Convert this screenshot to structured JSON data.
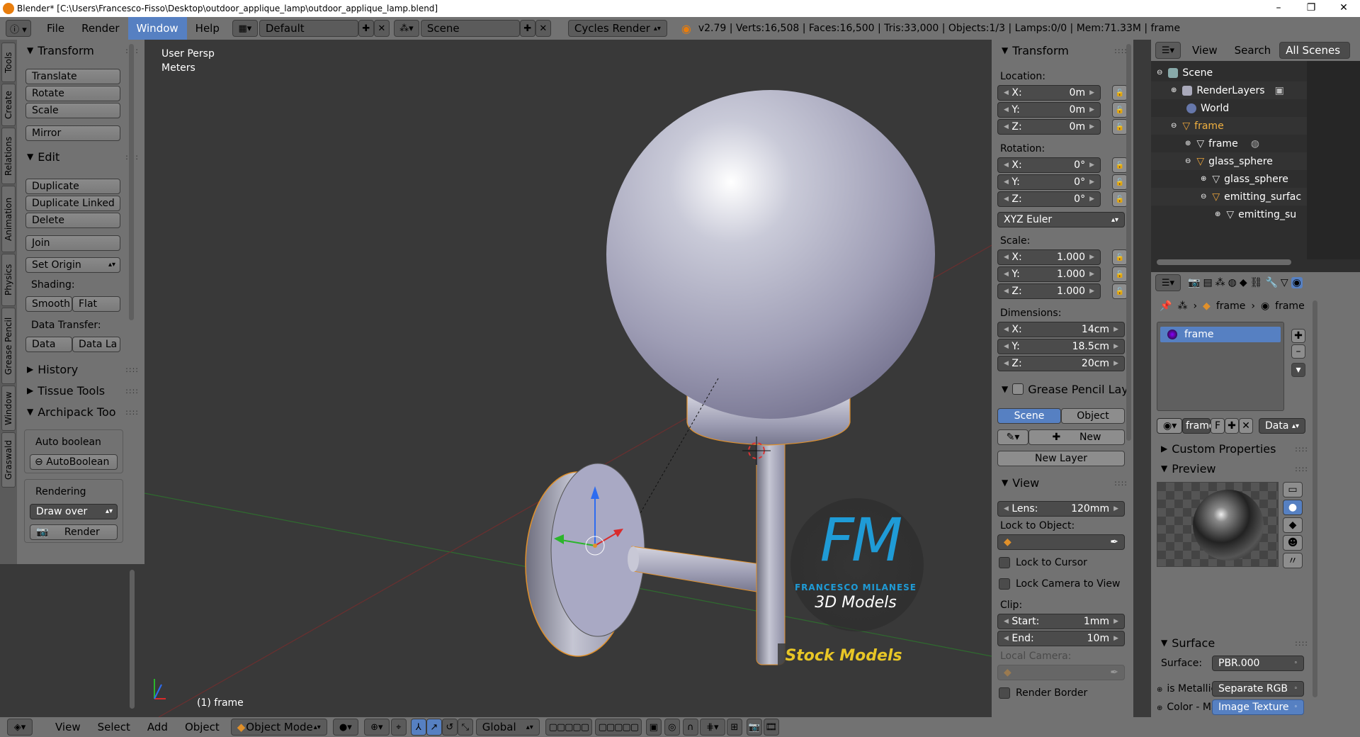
{
  "titlebar": {
    "title": "Blender* [C:\\Users\\Francesco-Fisso\\Desktop\\outdoor_applique_lamp\\outdoor_applique_lamp.blend]"
  },
  "header": {
    "menus": [
      "File",
      "Render",
      "Window",
      "Help"
    ],
    "active_menu": "Window",
    "screen_layout": "Default",
    "scene": "Scene",
    "engine": "Cycles Render",
    "stats": "v2.79 | Verts:16,508 | Faces:16,500 | Tris:33,000 | Objects:1/3 | Lamps:0/0 | Mem:71.33M | frame"
  },
  "left_tabs": [
    "Tools",
    "Create",
    "Relations",
    "Animation",
    "Physics",
    "Grease Pencil",
    "Window",
    "Graswald"
  ],
  "toolshelf": {
    "transform": {
      "title": "Transform",
      "buttons": [
        "Translate",
        "Rotate",
        "Scale",
        "Mirror"
      ]
    },
    "edit": {
      "title": "Edit",
      "buttons": [
        "Duplicate",
        "Duplicate Linked",
        "Delete",
        "Join"
      ],
      "set_origin": "Set Origin",
      "shading_label": "Shading:",
      "shading": [
        "Smooth",
        "Flat"
      ],
      "data_transfer_label": "Data Transfer:",
      "data_transfer": [
        "Data",
        "Data La"
      ]
    },
    "collapsed": [
      "History",
      "Tissue Tools"
    ],
    "archipack": {
      "title": "Archipack Too",
      "auto_boolean_label": "Auto boolean",
      "auto_boolean_button": "AutoBoolean",
      "rendering_label": "Rendering",
      "draw_over": "Draw over",
      "render_button": "Render"
    }
  },
  "viewport": {
    "view_name": "User Persp",
    "units": "Meters",
    "object_label": "(1) frame",
    "watermark": {
      "letters": "FM",
      "author": "FRANCESCO MILANESE",
      "subtitle": "3D Models",
      "badge": "Stock Models"
    }
  },
  "npanel": {
    "transform_title": "Transform",
    "location_label": "Location:",
    "location": [
      {
        "axis": "X:",
        "value": "0m"
      },
      {
        "axis": "Y:",
        "value": "0m"
      },
      {
        "axis": "Z:",
        "value": "0m"
      }
    ],
    "rotation_label": "Rotation:",
    "rotation": [
      {
        "axis": "X:",
        "value": "0°"
      },
      {
        "axis": "Y:",
        "value": "0°"
      },
      {
        "axis": "Z:",
        "value": "0°"
      }
    ],
    "rotation_mode": "XYZ Euler",
    "scale_label": "Scale:",
    "scale": [
      {
        "axis": "X:",
        "value": "1.000"
      },
      {
        "axis": "Y:",
        "value": "1.000"
      },
      {
        "axis": "Z:",
        "value": "1.000"
      }
    ],
    "dimensions_label": "Dimensions:",
    "dimensions": [
      {
        "axis": "X:",
        "value": "14cm"
      },
      {
        "axis": "Y:",
        "value": "18.5cm"
      },
      {
        "axis": "Z:",
        "value": "20cm"
      }
    ],
    "grease_pencil_title": "Grease Pencil Layer",
    "gp_tabs": [
      "Scene",
      "Object"
    ],
    "gp_new": "New",
    "gp_new_layer": "New Layer",
    "view_title": "View",
    "lens_label": "Lens:",
    "lens_value": "120mm",
    "lock_to_object_label": "Lock to Object:",
    "lock_to_cursor": "Lock to Cursor",
    "lock_camera": "Lock Camera to View",
    "clip_label": "Clip:",
    "clip_start_label": "Start:",
    "clip_start": "1mm",
    "clip_end_label": "End:",
    "clip_end": "10m",
    "local_camera_label": "Local Camera:",
    "render_border": "Render Border"
  },
  "outliner": {
    "header_items": [
      "View",
      "Search",
      "All Scenes"
    ],
    "tree": [
      {
        "label": "Scene",
        "indent": 0
      },
      {
        "label": "RenderLayers",
        "indent": 1
      },
      {
        "label": "World",
        "indent": 1
      },
      {
        "label": "frame",
        "indent": 1
      },
      {
        "label": "frame",
        "indent": 2
      },
      {
        "label": "glass_sphere",
        "indent": 2
      },
      {
        "label": "glass_sphere",
        "indent": 3
      },
      {
        "label": "emitting_surfac",
        "indent": 3
      },
      {
        "label": "emitting_su",
        "indent": 4
      }
    ]
  },
  "properties": {
    "breadcrumb": [
      "frame",
      "frame"
    ],
    "material_slot": "frame",
    "material_name": "frame",
    "material_f": "F",
    "link_type": "Data",
    "custom_properties": "Custom Properties",
    "preview_title": "Preview",
    "surface_title": "Surface",
    "surface_label": "Surface:",
    "surface_value": "PBR.000",
    "is_metallic_label": "is Metallic",
    "is_metallic_value": "Separate RGB",
    "color_label": "Color - Ma",
    "color_value": "Image Texture"
  },
  "bottombar": {
    "menus": [
      "View",
      "Select",
      "Add",
      "Object"
    ],
    "mode": "Object Mode",
    "orientation": "Global"
  },
  "colors": {
    "accent": "#5680c2",
    "header": "#727272",
    "viewport": "#393939",
    "outliner": "#2e2e2e"
  }
}
